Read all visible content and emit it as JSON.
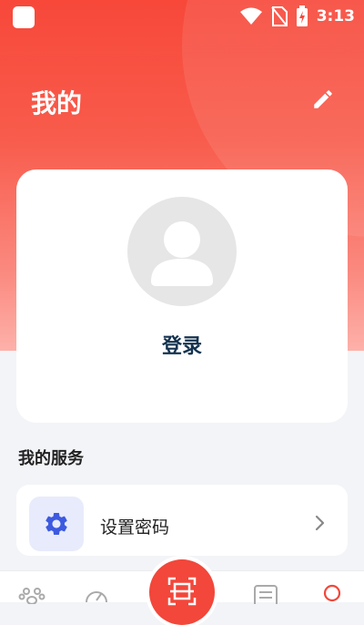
{
  "status_bar": {
    "time": "3:13",
    "icons": [
      "app-icon",
      "wifi-icon",
      "no-sim-icon",
      "battery-charging-icon"
    ]
  },
  "header": {
    "title": "我的",
    "edit_icon": "pencil-icon"
  },
  "profile": {
    "avatar_icon": "person-avatar-icon",
    "login_label": "登录"
  },
  "services": {
    "title": "我的服务",
    "items": [
      {
        "label": "设置密码",
        "icon": "gear-icon"
      }
    ]
  },
  "tabbar": {
    "items": [
      "paw-icon",
      "gauge-icon",
      "scan-icon",
      "document-icon",
      "profile-icon"
    ],
    "active": "profile-icon"
  },
  "colors": {
    "brand": "#f2473a",
    "settings_icon": "#3d5ae0",
    "login_text": "#14324f"
  }
}
